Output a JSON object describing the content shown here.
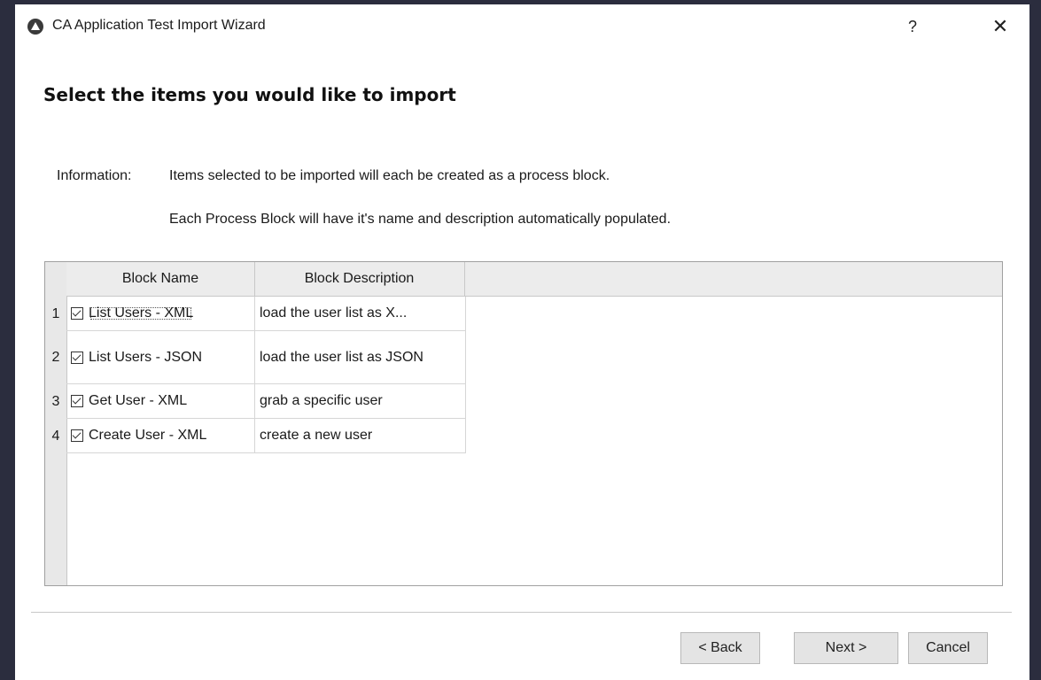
{
  "window": {
    "title": "CA Application Test Import Wizard",
    "help_label": "?",
    "close_label": "✕"
  },
  "page": {
    "heading": "Select the items you would like to import",
    "info_label": "Information:",
    "info_line1": "Items selected to be imported will each be created as a process block.",
    "info_line2": "Each Process Block will have it's name and description automatically populated."
  },
  "table": {
    "columns": [
      "Block Name",
      "Block Description"
    ],
    "rows": [
      {
        "num": "1",
        "checked": true,
        "name": "List Users - XML",
        "description": "load the user list as X..."
      },
      {
        "num": "2",
        "checked": true,
        "name": "List Users - JSON",
        "description": "load the user list as JSON"
      },
      {
        "num": "3",
        "checked": true,
        "name": "Get User - XML",
        "description": "grab a specific user"
      },
      {
        "num": "4",
        "checked": true,
        "name": "Create User - XML",
        "description": "create a new user"
      }
    ]
  },
  "buttons": {
    "back": "< Back",
    "next": "Next >",
    "cancel": "Cancel"
  }
}
